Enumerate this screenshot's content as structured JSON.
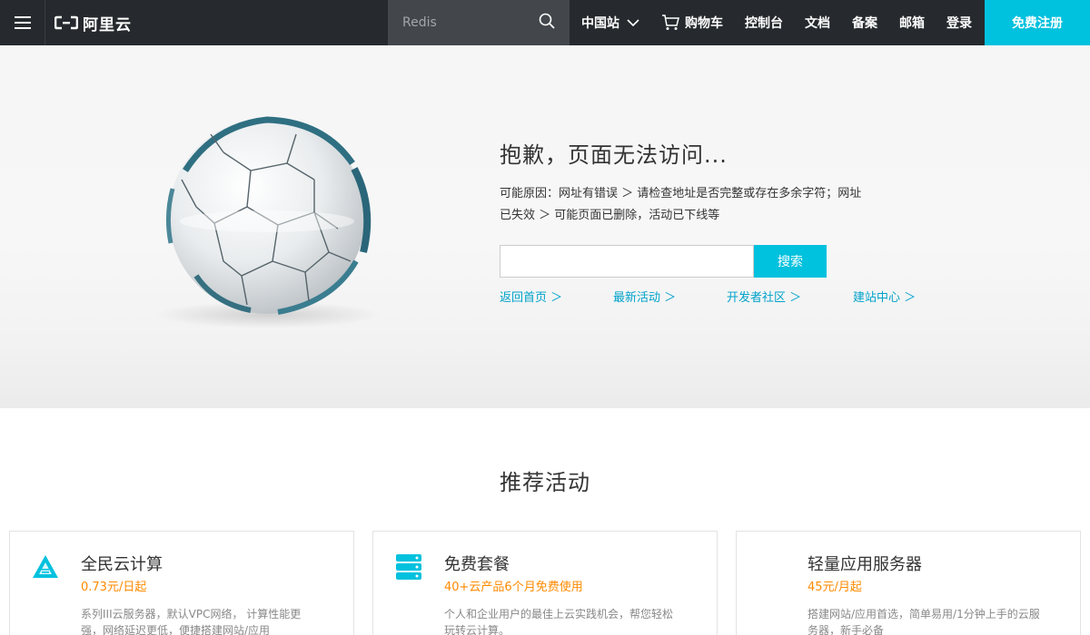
{
  "header": {
    "logo_text": "阿里云",
    "search_placeholder": "Redis",
    "region": "中国站",
    "nav": [
      "购物车",
      "控制台",
      "文档",
      "备案",
      "邮箱",
      "登录"
    ],
    "signup": "免费注册"
  },
  "error": {
    "title": "抱歉，页面无法访问...",
    "description": "可能原因：网址有错误 ＞ 请检查地址是否完整或存在多余字符；网址已失效 ＞ 可能页面已删除，活动已下线等",
    "search_button": "搜索",
    "links": [
      "返回首页 ＞",
      "最新活动 ＞",
      "开发者社区 ＞",
      "建站中心 ＞"
    ]
  },
  "recommend": {
    "title": "推荐活动",
    "cards": [
      {
        "icon": "triangle-cloud-icon",
        "title": "全民云计算",
        "price": "0.73元/日起",
        "desc": "系列III云服务器，默认VPC网络， 计算性能更强，网络延迟更低，便捷搭建网站/应用"
      },
      {
        "icon": "server-stack-icon",
        "title": "免费套餐",
        "price": "40+云产品6个月免费使用",
        "desc": "个人和企业用户的最佳上云实践机会，帮您轻松玩转云计算。"
      },
      {
        "icon": "",
        "title": "轻量应用服务器",
        "price": "45元/月起",
        "desc": "搭建网站/应用首选，简单易用/1分钟上手的云服务器，新手必备"
      }
    ]
  },
  "colors": {
    "accent": "#00c1de",
    "topbar": "#262a2e",
    "price": "#ff8a00",
    "link": "#00a2ca"
  }
}
